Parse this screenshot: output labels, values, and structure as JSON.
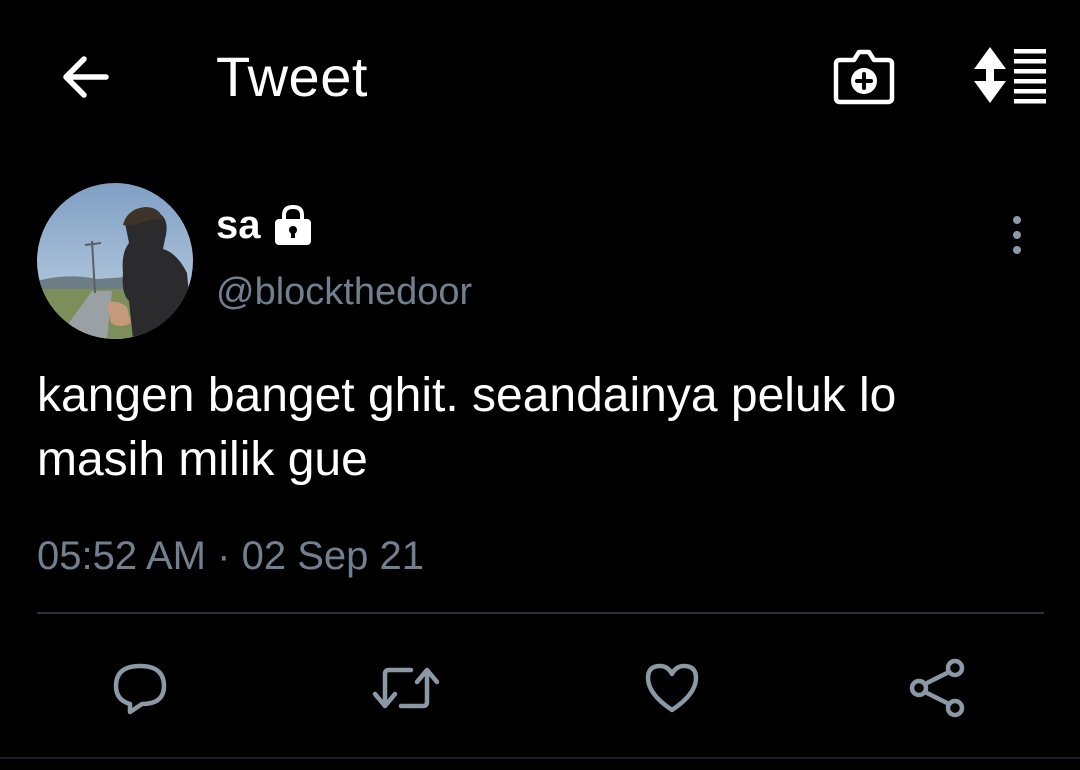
{
  "header": {
    "title": "Tweet",
    "back_icon": "arrow-left-icon",
    "camera_icon": "camera-add-icon",
    "sort_icon": "sort-list-icon"
  },
  "tweet": {
    "display_name": "sa",
    "protected_icon": "lock-icon",
    "handle": "@blockthedoor",
    "more_icon": "more-vertical-icon",
    "text": "kangen banget ghit. seandainya peluk lo masih milik gue",
    "time": "05:52 AM",
    "separator": "·",
    "date": "02 Sep 21"
  },
  "actions": {
    "reply_icon": "reply-icon",
    "retweet_icon": "retweet-icon",
    "like_icon": "heart-icon",
    "share_icon": "share-icon"
  },
  "colors": {
    "background": "#000000",
    "primary_text": "#ffffff",
    "secondary_text": "#71808f",
    "divider": "#2a3138",
    "action_icon": "#8b98a5"
  }
}
